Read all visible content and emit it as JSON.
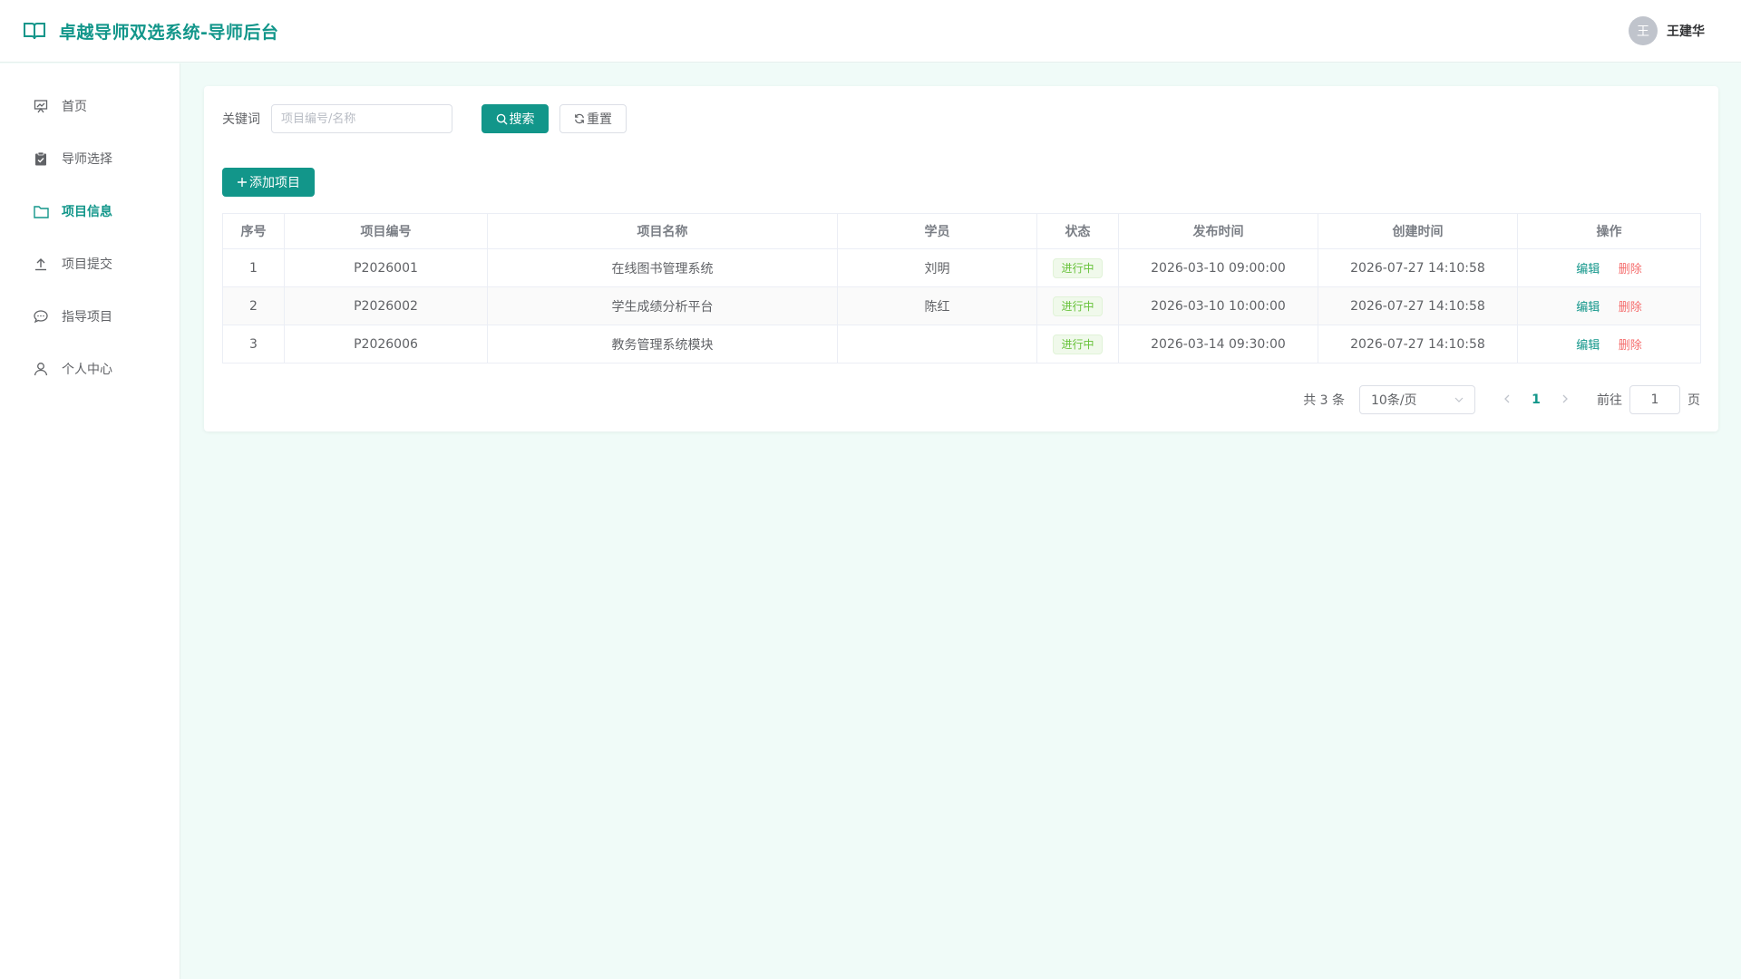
{
  "header": {
    "title": "卓越导师双选系统-导师后台",
    "user": {
      "avatar_letter": "王",
      "name": "王建华"
    }
  },
  "sidebar": {
    "items": [
      {
        "label": "首页",
        "icon": "presentation-icon",
        "active": false
      },
      {
        "label": "导师选择",
        "icon": "clipboard-check-icon",
        "active": false
      },
      {
        "label": "项目信息",
        "icon": "folder-icon",
        "active": true
      },
      {
        "label": "项目提交",
        "icon": "upload-icon",
        "active": false
      },
      {
        "label": "指导项目",
        "icon": "chat-bubble-icon",
        "active": false
      },
      {
        "label": "个人中心",
        "icon": "user-icon",
        "active": false
      }
    ]
  },
  "search": {
    "label": "关键词",
    "placeholder": "项目编号/名称",
    "value": "",
    "search_button": "搜索",
    "reset_button": "重置"
  },
  "toolbar": {
    "add_button": "添加项目"
  },
  "table": {
    "columns": [
      "序号",
      "项目编号",
      "项目名称",
      "学员",
      "状态",
      "发布时间",
      "创建时间",
      "操作"
    ],
    "rows": [
      {
        "index": "1",
        "code": "P2026001",
        "name": "在线图书管理系统",
        "student": "刘明",
        "status": "进行中",
        "publish_time": "2026-03-10 09:00:00",
        "create_time": "2026-07-27 14:10:58",
        "edit": "编辑",
        "delete": "删除"
      },
      {
        "index": "2",
        "code": "P2026002",
        "name": "学生成绩分析平台",
        "student": "陈红",
        "status": "进行中",
        "publish_time": "2026-03-10 10:00:00",
        "create_time": "2026-07-27 14:10:58",
        "edit": "编辑",
        "delete": "删除"
      },
      {
        "index": "3",
        "code": "P2026006",
        "name": "教务管理系统模块",
        "student": "",
        "status": "进行中",
        "publish_time": "2026-03-14 09:30:00",
        "create_time": "2026-07-27 14:10:58",
        "edit": "编辑",
        "delete": "删除"
      }
    ]
  },
  "pagination": {
    "total_text": "共 3 条",
    "page_size": "10条/页",
    "current_page": "1",
    "goto_label": "前往",
    "goto_value": "1",
    "page_suffix": "页"
  },
  "colors": {
    "primary": "#12968a",
    "danger": "#f56c6c",
    "success": "#67c23a",
    "background": "#f0fbf8"
  }
}
